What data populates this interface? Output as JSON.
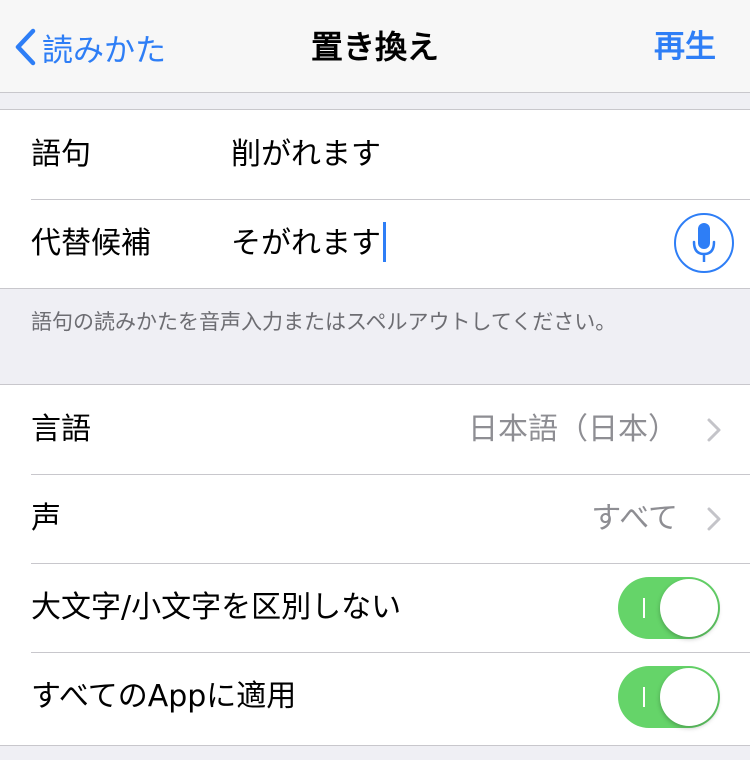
{
  "navbar": {
    "back_label": "読みかた",
    "title": "置き換え",
    "play_label": "再生"
  },
  "phrase_group": {
    "phrase": {
      "label": "語句",
      "value": "削がれます"
    },
    "alternative": {
      "label": "代替候補",
      "value": "そがれます"
    },
    "mic_icon": "microphone-icon"
  },
  "hint": "語句の読みかたを音声入力またはスペルアウトしてください。",
  "settings": {
    "language": {
      "label": "言語",
      "value": "日本語（日本）"
    },
    "voice": {
      "label": "声",
      "value": "すべて"
    },
    "ignore_case": {
      "label": "大文字/小文字を区別しない",
      "on": true
    },
    "all_apps": {
      "label": "すべてのAppに適用",
      "on": true
    }
  },
  "colors": {
    "accent": "#2e7ef6",
    "toggle_on": "#65d469",
    "background": "#efeff4"
  }
}
